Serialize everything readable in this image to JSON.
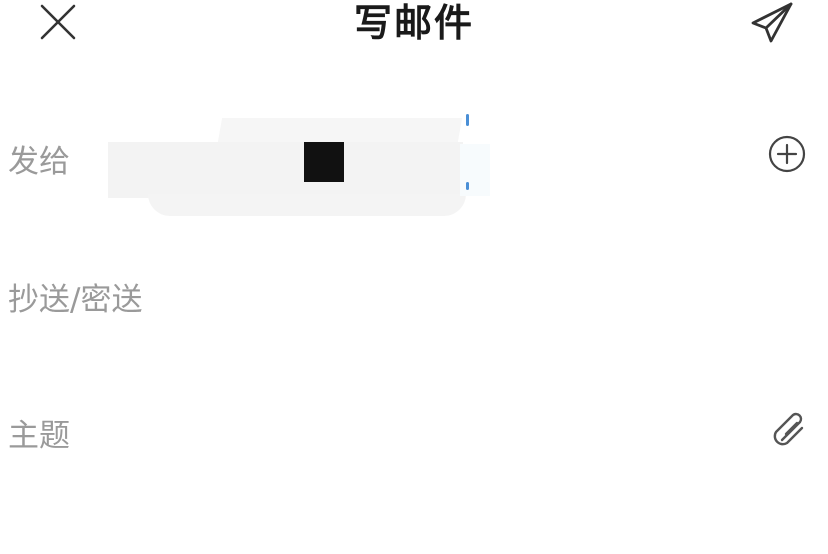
{
  "header": {
    "title": "写邮件",
    "close_icon": "close-icon",
    "send_icon": "send-icon"
  },
  "compose": {
    "to_label": "发给",
    "cc_bcc_label": "抄送/密送",
    "subject_label": "主题",
    "add_recipient_icon": "plus-circle-icon",
    "attachment_icon": "paperclip-icon"
  },
  "colors": {
    "title_text": "#1a1a1a",
    "label_text": "#9a9a9a",
    "icon_stroke": "#333333",
    "background": "#ffffff"
  }
}
